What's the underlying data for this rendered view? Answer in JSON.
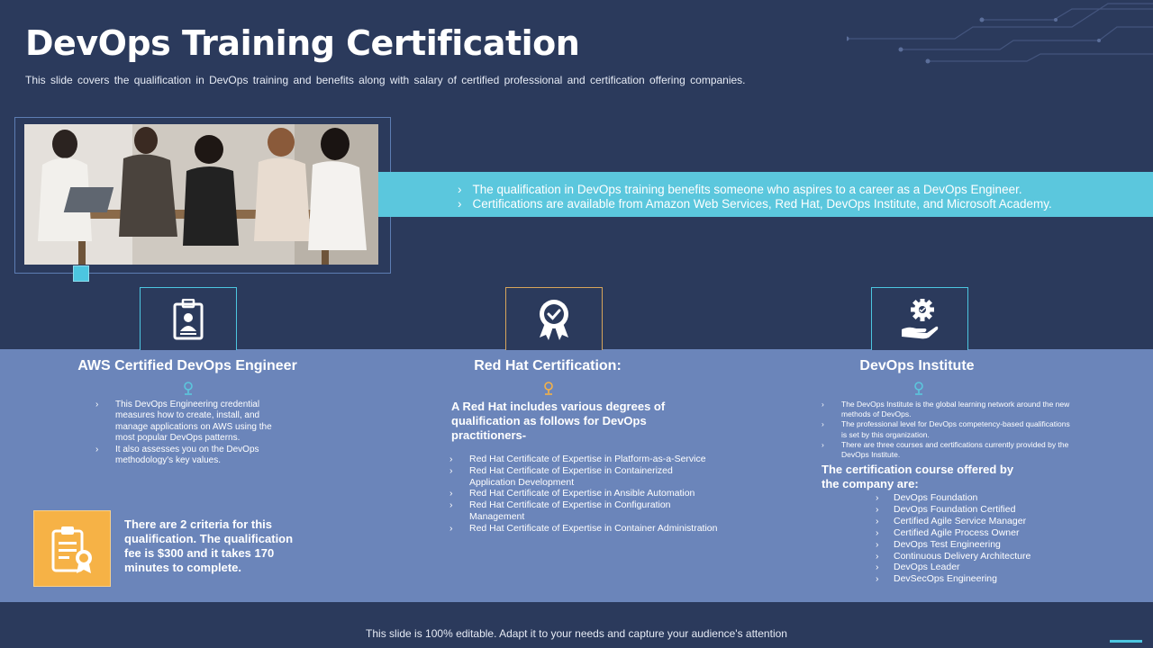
{
  "header": {
    "title": "DevOps Training Certification",
    "subtitle": "This slide covers the qualification in DevOps training and benefits along with salary of certified professional and certification offering companies."
  },
  "banner": {
    "points": [
      "The qualification in DevOps training benefits someone who aspires to a career as a DevOps Engineer.",
      "Certifications are available from Amazon Web Services, Red Hat, DevOps Institute, and Microsoft Academy."
    ]
  },
  "columns": {
    "aws": {
      "icon": "id-badge-icon",
      "title": "AWS Certified DevOps Engineer",
      "points": [
        "This DevOps Engineering credential measures how to create, install, and manage applications on AWS using the most popular DevOps patterns.",
        "It also assesses you on the DevOps methodology's key values."
      ],
      "criteria_icon": "certificate-icon",
      "criteria": "There are 2 criteria for this qualification. The qualification fee is $300 and it takes 170 minutes to complete."
    },
    "redhat": {
      "icon": "award-ribbon-icon",
      "title": "Red Hat Certification:",
      "intro": "A Red Hat includes various degrees of qualification as follows for DevOps practitioners-",
      "points": [
        "Red Hat Certificate of Expertise in Platform-as-a-Service",
        "Red Hat Certificate of Expertise in Containerized Application Development",
        "Red Hat Certificate of Expertise in Ansible Automation",
        "Red Hat Certificate of Expertise in Configuration Management",
        "Red Hat Certificate of Expertise in Container Administration"
      ]
    },
    "devops_institute": {
      "icon": "hand-gear-icon",
      "title": "DevOps Institute",
      "points": [
        "The DevOps Institute is the global learning network around the new methods of DevOps.",
        "The professional level for DevOps competency-based qualifications is set by this organization.",
        "There are three courses and certifications currently provided by the DevOps Institute."
      ],
      "subheading": "The certification course offered by the company are:",
      "courses": [
        "DevOps Foundation",
        "DevOps Foundation Certified",
        "Certified Agile Service Manager",
        "Certified Agile Process Owner",
        "DevOps Test Engineering",
        "Continuous Delivery Architecture",
        "DevOps Leader",
        "DevSecOps Engineering"
      ]
    }
  },
  "footer": {
    "text": "This slide is 100% editable. Adapt it to your needs and capture your audience's attention"
  },
  "colors": {
    "background": "#2b3a5c",
    "panel": "#6b85ba",
    "accent_cyan": "#5bc7dd",
    "accent_gold": "#f6b246"
  }
}
